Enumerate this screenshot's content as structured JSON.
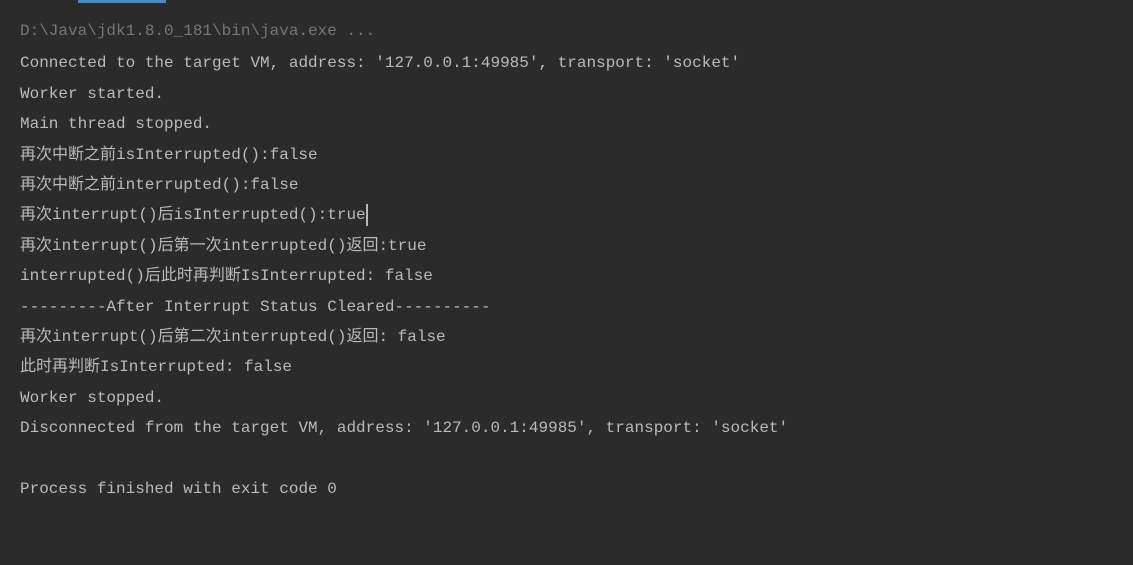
{
  "console": {
    "command": "D:\\Java\\jdk1.8.0_181\\bin\\java.exe ...",
    "lines": [
      "Connected to the target VM, address: '127.0.0.1:49985', transport: 'socket'",
      "Worker started.",
      "Main thread stopped.",
      "再次中断之前isInterrupted():false",
      "再次中断之前interrupted():false",
      "再次interrupt()后isInterrupted():true",
      "再次interrupt()后第一次interrupted()返回:true",
      "interrupted()后此时再判断IsInterrupted: false",
      "---------After Interrupt Status Cleared----------",
      "再次interrupt()后第二次interrupted()返回: false",
      "此时再判断IsInterrupted: false",
      "Worker stopped.",
      "Disconnected from the target VM, address: '127.0.0.1:49985', transport: 'socket'",
      "",
      "Process finished with exit code 0"
    ],
    "cursor_line_index": 5
  }
}
